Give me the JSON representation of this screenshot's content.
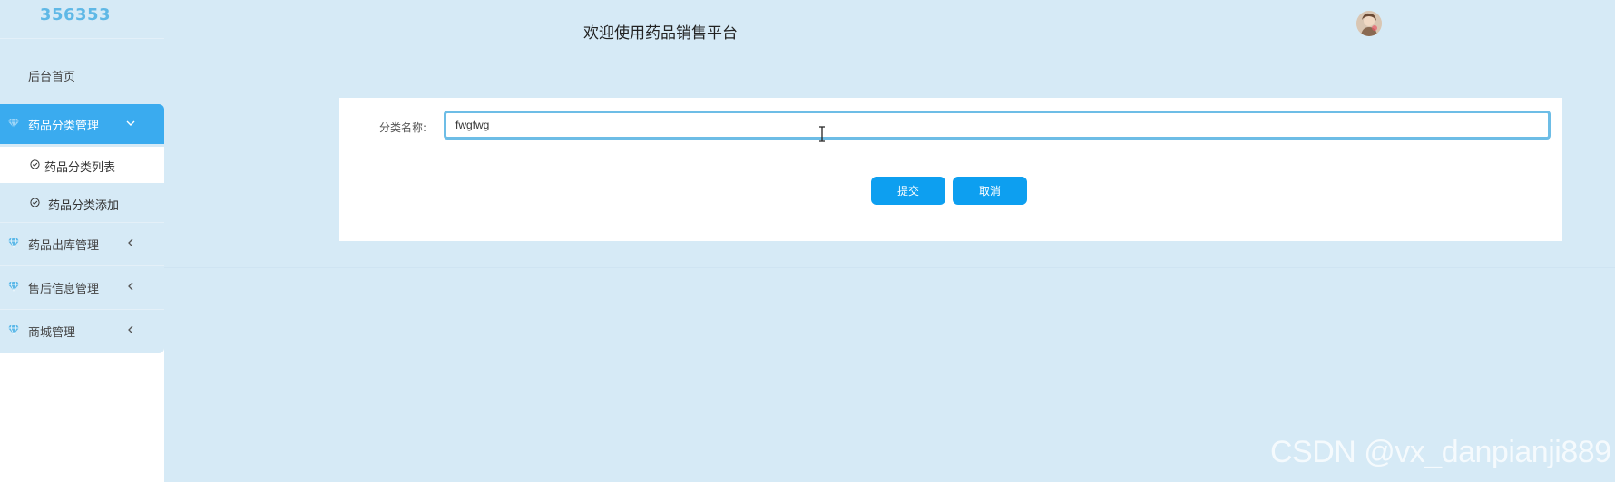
{
  "sidebar": {
    "brand": "356353",
    "home": "后台首页",
    "groups": [
      {
        "label": "药品分类管理",
        "expanded": true,
        "icon": "gem-icon",
        "children": [
          {
            "label": "药品分类列表",
            "selected": true
          },
          {
            "label": "药品分类添加",
            "selected": false
          }
        ]
      },
      {
        "label": "药品出库管理",
        "expanded": false,
        "icon": "gem-icon"
      },
      {
        "label": "售后信息管理",
        "expanded": false,
        "icon": "gem-icon"
      },
      {
        "label": "商城管理",
        "expanded": false,
        "icon": "gem-icon"
      }
    ]
  },
  "header": {
    "title": "欢迎使用药品销售平台",
    "avatar": "user-avatar"
  },
  "form": {
    "category_name_label": "分类名称:",
    "category_name_value": "fwgfwg",
    "submit_label": "提交",
    "cancel_label": "取消"
  },
  "colors": {
    "accent": "#0d9ff0",
    "active_nav": "#3aabef",
    "background": "#d6eaf6",
    "input_border": "#6dbde6"
  },
  "watermark": "CSDN @vx_danpianji889"
}
